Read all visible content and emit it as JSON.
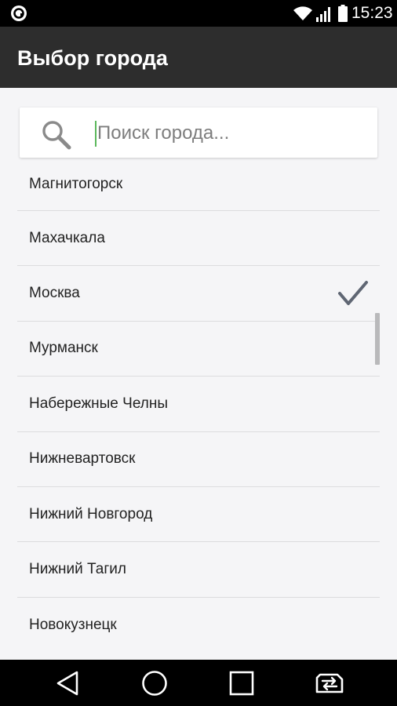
{
  "status_bar": {
    "time": "15:23",
    "icons": [
      "app-notification-icon",
      "wifi-icon",
      "signal-icon",
      "battery-icon"
    ]
  },
  "app_bar": {
    "title": "Выбор города"
  },
  "search": {
    "placeholder": "Поиск города...",
    "value": "",
    "icon": "search-icon"
  },
  "cities": [
    {
      "name": "Магнитогорск",
      "selected": false
    },
    {
      "name": "Махачкала",
      "selected": false
    },
    {
      "name": "Москва",
      "selected": true
    },
    {
      "name": "Мурманск",
      "selected": false
    },
    {
      "name": "Набережные Челны",
      "selected": false
    },
    {
      "name": "Нижневартовск",
      "selected": false
    },
    {
      "name": "Нижний Новгород",
      "selected": false
    },
    {
      "name": "Нижний Тагил",
      "selected": false
    },
    {
      "name": "Новокузнецк",
      "selected": false
    }
  ],
  "nav_bar": {
    "buttons": [
      "back-icon",
      "home-icon",
      "recents-icon",
      "switch-sim-icon"
    ]
  },
  "colors": {
    "app_bar_bg": "#2d2d2d",
    "list_bg": "#f5f5f7",
    "check_color": "#5f6673",
    "cursor_color": "#5bb85b"
  }
}
